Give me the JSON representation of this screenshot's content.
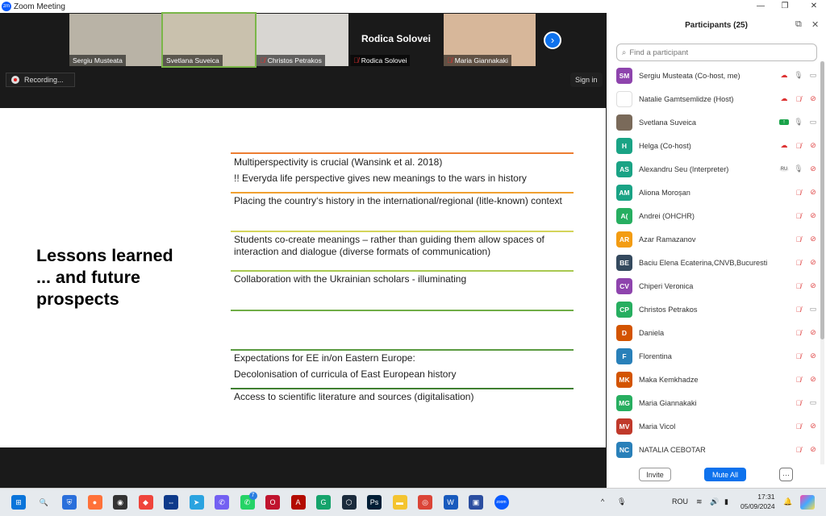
{
  "window": {
    "title": "Zoom Meeting",
    "min": "—",
    "max": "❐",
    "close": "✕"
  },
  "videos": [
    {
      "name": "Sergiu Musteata",
      "muted": false,
      "bg": "#b9b3a6"
    },
    {
      "name": "Svetlana Suveica",
      "muted": false,
      "bg": "#c9c1ad",
      "active": true
    },
    {
      "name": "Christos Petrakos",
      "muted": true,
      "bg": "#d8d6d2"
    },
    {
      "name": "Rodica Solovei",
      "muted": true,
      "bg": "#1a1a1a",
      "center_label": "Rodica Solovei"
    },
    {
      "name": "Maria Giannakaki",
      "muted": true,
      "bg": "#d7b79a"
    }
  ],
  "stage": {
    "recording": "Recording...",
    "sign_in": "Sign in",
    "next": "›"
  },
  "slide": {
    "title": [
      "Lessons learned",
      "... and future",
      "prospects"
    ],
    "items": [
      "Multiperspectivity is crucial (Wansink et al. 2018)",
      "!! Everyda life perspective gives new meanings to the wars in history",
      "Placing the country‘s history in the international/regional (litle-known) context",
      "Students co-create meanings – rather than guiding them allow spaces of interaction and dialogue (diverse formats of communication)",
      "Collaboration with the Ukrainian scholars - illuminating",
      "Expectations for EE in/on Eastern Europe:",
      "Decolonisation of curricula of East European history",
      "Access to scientific literature and sources (digitalisation)"
    ],
    "line_colors": [
      "#ed7d31",
      "#f0a030",
      "#d4d45a",
      "#a8c850",
      "#70ad47",
      "#5a9a40",
      "#3f7f30"
    ]
  },
  "participants": {
    "title": "Participants (25)",
    "search_placeholder": "Find a participant",
    "invite": "Invite",
    "mute_all": "Mute All",
    "more": "···",
    "list": [
      {
        "initials": "SM",
        "color": "#8e44ad",
        "name": "Sergiu Musteata (Co-host, me)",
        "status": "cloud",
        "mic": "on",
        "cam": "on"
      },
      {
        "initials": "",
        "color": "#ffffff",
        "name": "Natalie Gamtsemlidze (Host)",
        "status": "cloud",
        "mic": "off",
        "cam": "off",
        "logo": true
      },
      {
        "initials": "",
        "color": "#7a6a5a",
        "name": "Svetlana Suveica",
        "status": "share",
        "mic": "on",
        "cam": "on",
        "photo": true
      },
      {
        "initials": "H",
        "color": "#1aa385",
        "name": "Helga (Co-host)",
        "status": "cloud",
        "mic": "off",
        "cam": "off"
      },
      {
        "initials": "AS",
        "color": "#1aa385",
        "name": "Alexandru Seu (Interpreter)",
        "status": "RU",
        "mic": "on",
        "cam": "off"
      },
      {
        "initials": "AM",
        "color": "#1aa385",
        "name": "Aliona Moroșan",
        "mic": "off",
        "cam": "off"
      },
      {
        "initials": "A(",
        "color": "#27ae60",
        "name": "Andrei (OHCHR)",
        "mic": "off",
        "cam": "off"
      },
      {
        "initials": "AR",
        "color": "#f39c12",
        "name": "Azar Ramazanov",
        "mic": "off",
        "cam": "off"
      },
      {
        "initials": "BE",
        "color": "#34495e",
        "name": "Baciu Elena Ecaterina,CNVB,Bucuresti",
        "mic": "off",
        "cam": "off"
      },
      {
        "initials": "CV",
        "color": "#8e44ad",
        "name": "Chiperi Veronica",
        "mic": "off",
        "cam": "off"
      },
      {
        "initials": "CP",
        "color": "#27ae60",
        "name": "Christos Petrakos",
        "mic": "off",
        "cam": "on"
      },
      {
        "initials": "D",
        "color": "#d35400",
        "name": "Daniela",
        "mic": "off",
        "cam": "off"
      },
      {
        "initials": "F",
        "color": "#2980b9",
        "name": "Florentina",
        "mic": "off",
        "cam": "off"
      },
      {
        "initials": "MK",
        "color": "#d35400",
        "name": "Maka Kemkhadze",
        "mic": "off",
        "cam": "off"
      },
      {
        "initials": "MG",
        "color": "#27ae60",
        "name": "Maria Giannakaki",
        "mic": "off",
        "cam": "on"
      },
      {
        "initials": "MV",
        "color": "#c0392b",
        "name": "Maria Vicol",
        "mic": "off",
        "cam": "off"
      },
      {
        "initials": "NC",
        "color": "#2980b9",
        "name": "NATALIA CEBOTAR",
        "mic": "off",
        "cam": "off"
      }
    ]
  },
  "taskbar": {
    "apps": [
      {
        "name": "start",
        "color": "#0a74da",
        "glyph": "⊞"
      },
      {
        "name": "search",
        "color": "#e6eaee",
        "glyph": "🔍"
      },
      {
        "name": "defender",
        "color": "#2a6fdb",
        "glyph": "⛨"
      },
      {
        "name": "firefox",
        "color": "#ff7139",
        "glyph": "●"
      },
      {
        "name": "app-disc",
        "color": "#333",
        "glyph": "◉"
      },
      {
        "name": "anydesk",
        "color": "#ef443b",
        "glyph": "◆"
      },
      {
        "name": "teamviewer",
        "color": "#0e3a8a",
        "glyph": "⇔"
      },
      {
        "name": "telegram",
        "color": "#2aa3e0",
        "glyph": "➤"
      },
      {
        "name": "viber",
        "color": "#7360f2",
        "glyph": "✆"
      },
      {
        "name": "whatsapp",
        "color": "#25d366",
        "glyph": "✆",
        "badge": "7"
      },
      {
        "name": "opera",
        "color": "#c0142e",
        "glyph": "O"
      },
      {
        "name": "acrobat",
        "color": "#b30b00",
        "glyph": "A"
      },
      {
        "name": "grammarly",
        "color": "#15a36b",
        "glyph": "G"
      },
      {
        "name": "app-hex",
        "color": "#1b2b3c",
        "glyph": "⬡"
      },
      {
        "name": "photoshop",
        "color": "#001e36",
        "glyph": "Ps"
      },
      {
        "name": "explorer",
        "color": "#f4c430",
        "glyph": "▬"
      },
      {
        "name": "chrome",
        "color": "#db4437",
        "glyph": "◎"
      },
      {
        "name": "word",
        "color": "#185abd",
        "glyph": "W"
      },
      {
        "name": "save-app",
        "color": "#2b4ea0",
        "glyph": "▣"
      },
      {
        "name": "zoom",
        "color": "#0b5cff",
        "glyph": "zoom"
      }
    ],
    "lang": "ROU",
    "time": "17:31",
    "date": "05/09/2024"
  }
}
